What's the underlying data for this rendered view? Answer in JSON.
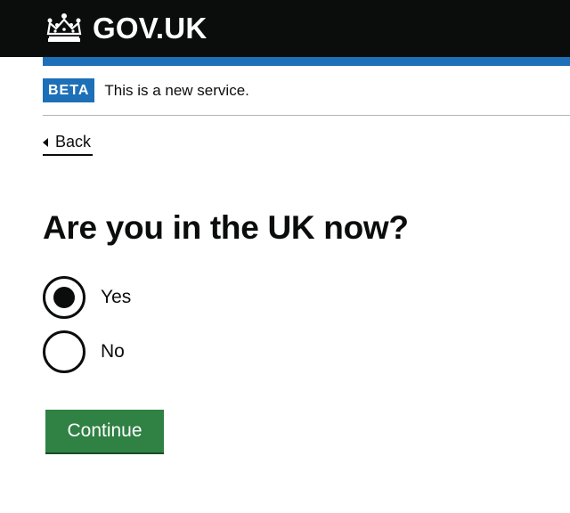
{
  "header": {
    "logo_icon": "crown-icon",
    "logo_text": "GOV.UK",
    "background_color": "#0b0c0c",
    "accent_bar_color": "#1d70b8"
  },
  "phase_banner": {
    "tag": "BETA",
    "text": "This is a new service.",
    "tag_color": "#1d70b8"
  },
  "back_link": {
    "icon": "back-chevron-icon",
    "label": "Back"
  },
  "form": {
    "question": "Are you in the UK now?",
    "options": [
      {
        "label": "Yes",
        "selected": true
      },
      {
        "label": "No",
        "selected": false
      }
    ],
    "submit_label": "Continue",
    "submit_color": "#2f8144"
  }
}
